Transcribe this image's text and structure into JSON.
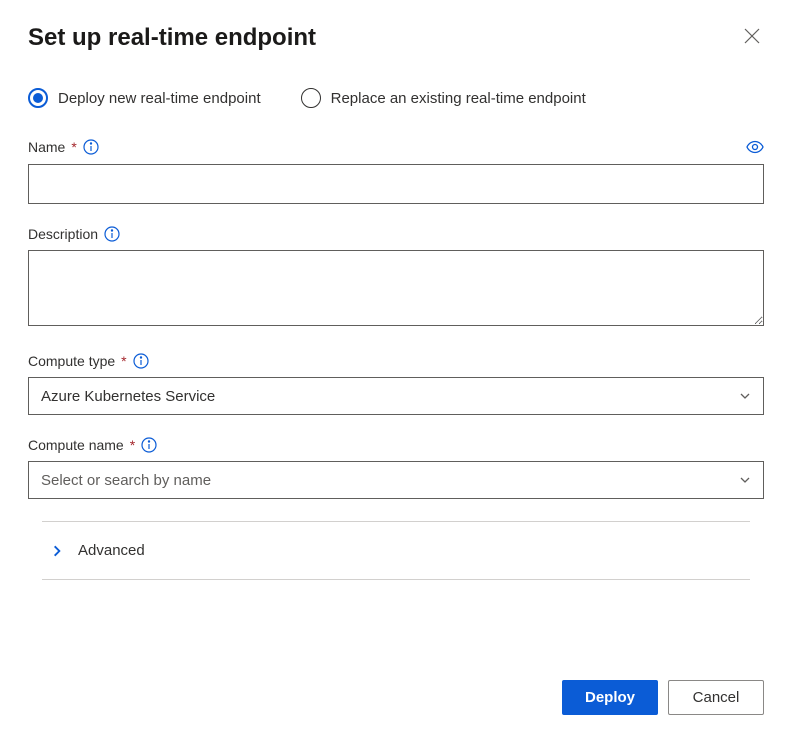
{
  "title": "Set up real-time endpoint",
  "radios": {
    "deploy_new": "Deploy new real-time endpoint",
    "replace_existing": "Replace an existing real-time endpoint"
  },
  "fields": {
    "name": {
      "label": "Name"
    },
    "description": {
      "label": "Description"
    },
    "compute_type": {
      "label": "Compute type",
      "value": "Azure Kubernetes Service"
    },
    "compute_name": {
      "label": "Compute name",
      "placeholder": "Select or search by name"
    }
  },
  "advanced": {
    "label": "Advanced"
  },
  "buttons": {
    "deploy": "Deploy",
    "cancel": "Cancel"
  }
}
